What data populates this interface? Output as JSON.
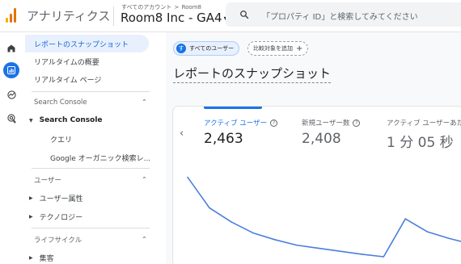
{
  "header": {
    "app_name": "アナリティクス",
    "account_crumb": "すべてのアカウント",
    "account_crumb_sep": ">",
    "account_name": "Room8",
    "property_name": "Room8 Inc - GA4",
    "property_caret": "▾",
    "search_placeholder": "「プロパティ ID」と検索してみてください",
    "logo_colors": [
      "#f9ab00",
      "#e37400",
      "#e37400"
    ]
  },
  "rail": {
    "items": [
      {
        "icon": "home-icon"
      },
      {
        "icon": "reports-icon",
        "active": true
      },
      {
        "icon": "explore-icon"
      },
      {
        "icon": "advertising-icon"
      }
    ]
  },
  "sidebar": {
    "top_items": [
      "レポートのスナップショット",
      "リアルタイムの概要",
      "リアルタイム ページ"
    ],
    "section1": {
      "header": "Search Console",
      "caret": "⌃",
      "group": "Search Console",
      "children": [
        "クエリ",
        "Google オーガニック検索レ..."
      ]
    },
    "section2": {
      "header": "ユーザー",
      "caret": "⌃",
      "children": [
        "ユーザー属性",
        "テクノロジー"
      ]
    },
    "section3": {
      "header": "ライフサイクル",
      "caret": "⌃",
      "children": [
        "集客"
      ]
    }
  },
  "main": {
    "chip_all_users": "すべてのユーザー",
    "chip_avatar": "す",
    "chip_add_comparison": "比較対象を追加",
    "chip_add_plus": "+",
    "page_title": "レポートのスナップショット",
    "prev_arrow": "‹",
    "metrics": [
      {
        "label": "アクティブ ユーザー",
        "value": "2,463",
        "active": true
      },
      {
        "label": "新規ユーザー数",
        "value": "2,408",
        "active": false
      },
      {
        "label": "アクティブ ユーザーあた",
        "value": "1 分 05 秒",
        "active": false
      }
    ],
    "help_glyph": "?"
  },
  "chart_data": {
    "type": "line",
    "series": [
      {
        "values": [
          130,
          80,
          57,
          39,
          28,
          19,
          14,
          9,
          4,
          0,
          62,
          41,
          30,
          21
        ]
      }
    ],
    "ylim": [
      0,
      140
    ],
    "grid": false,
    "line_color": "#4a7fdc"
  }
}
